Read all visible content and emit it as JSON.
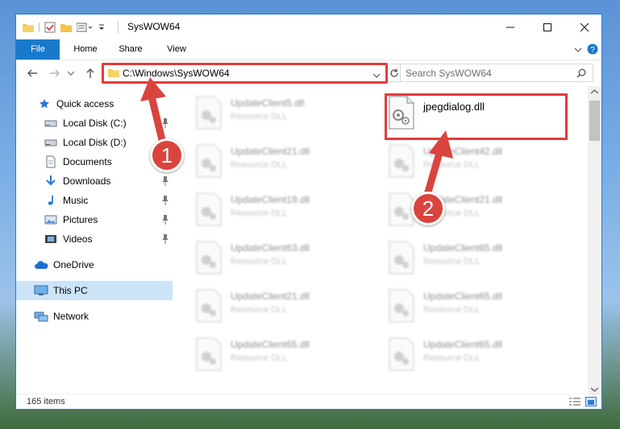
{
  "window": {
    "title": "SysWOW64"
  },
  "ribbon": {
    "tabs": [
      "File",
      "Home",
      "Share",
      "View"
    ]
  },
  "address": {
    "path": "C:\\Windows\\SysWOW64"
  },
  "search": {
    "placeholder": "Search SysWOW64"
  },
  "nav": {
    "quick_access": "Quick access",
    "items": [
      {
        "label": "Local Disk (C:)",
        "icon": "drive-icon",
        "pinned": true
      },
      {
        "label": "Local Disk (D:)",
        "icon": "drive-icon",
        "pinned": false
      },
      {
        "label": "Documents",
        "icon": "documents-icon",
        "pinned": true
      },
      {
        "label": "Downloads",
        "icon": "downloads-icon",
        "pinned": true
      },
      {
        "label": "Music",
        "icon": "music-icon",
        "pinned": true
      },
      {
        "label": "Pictures",
        "icon": "pictures-icon",
        "pinned": true
      },
      {
        "label": "Videos",
        "icon": "videos-icon",
        "pinned": true
      }
    ],
    "onedrive": "OneDrive",
    "this_pc": "This PC",
    "network": "Network"
  },
  "files": {
    "highlight": {
      "name": "jpegdialog.dll"
    },
    "left_column": [
      {
        "name": "UpdateClient5.dll",
        "type": "Resource DLL"
      },
      {
        "name": "UpdateClient21.dll",
        "type": "Resource DLL"
      },
      {
        "name": "UpdateClient19.dll",
        "type": "Resource DLL"
      },
      {
        "name": "UpdateClient63.dll",
        "type": "Resource DLL"
      },
      {
        "name": "UpdateClient21.dll",
        "type": "Resource DLL"
      },
      {
        "name": "UpdateClient65.dll",
        "type": "Resource DLL"
      }
    ],
    "right_column": [
      {
        "name": "UpdateClient42.dll",
        "type": "Resource DLL"
      },
      {
        "name": "UpdateClient21.dll",
        "type": "Resource DLL"
      },
      {
        "name": "UpdateClient65.dll",
        "type": "Resource DLL"
      },
      {
        "name": "UpdateClient65.dll",
        "type": "Resource DLL"
      },
      {
        "name": "UpdateClient65.dll",
        "type": "Resource DLL"
      }
    ]
  },
  "status": {
    "item_count": "165 items"
  },
  "annotations": {
    "step1": "1",
    "step2": "2",
    "color": "#d9443e"
  }
}
